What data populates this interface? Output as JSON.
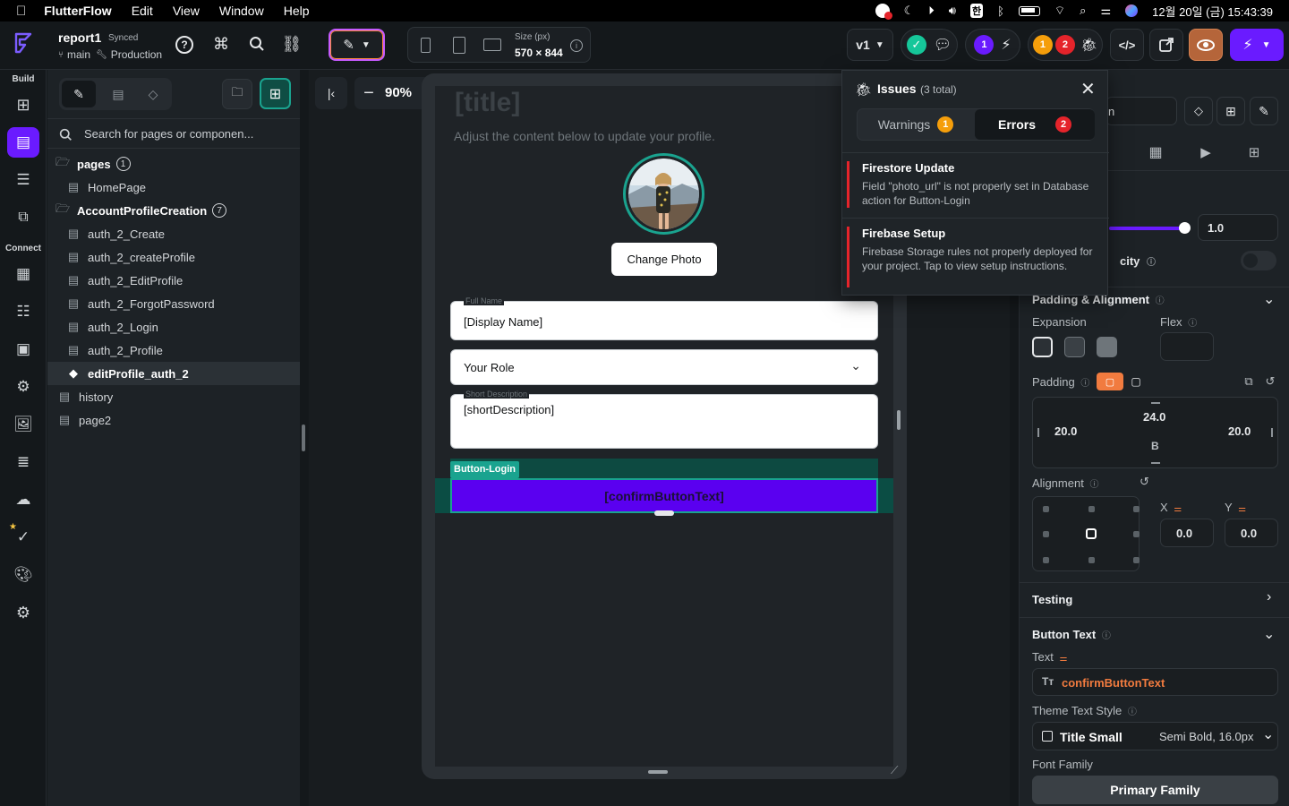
{
  "menubar": {
    "app_name": "FlutterFlow",
    "items": [
      "Edit",
      "View",
      "Window",
      "Help"
    ],
    "datetime": "12월 20일 (금)  15:43:39",
    "ime": "한"
  },
  "project": {
    "name": "report1",
    "sync_status": "Synced",
    "branch": "main",
    "environment": "Production"
  },
  "toolbar": {
    "size_label": "Size (px)",
    "size_value": "570 × 844",
    "version": "v1",
    "badge_purple": "1",
    "badge_orange": "1",
    "badge_red": "2"
  },
  "leftnav": {
    "build_label": "Build",
    "connect_label": "Connect"
  },
  "panel": {
    "search_placeholder": "Search for pages or componen...",
    "tree": [
      {
        "label": "pages",
        "count": "1",
        "type": "folder"
      },
      {
        "label": "HomePage",
        "type": "page"
      },
      {
        "label": "AccountProfileCreation",
        "count": "7",
        "type": "folder"
      },
      {
        "label": "auth_2_Create",
        "type": "page"
      },
      {
        "label": "auth_2_createProfile",
        "type": "page"
      },
      {
        "label": "auth_2_EditProfile",
        "type": "page"
      },
      {
        "label": "auth_2_ForgotPassword",
        "type": "page"
      },
      {
        "label": "auth_2_Login",
        "type": "page"
      },
      {
        "label": "auth_2_Profile",
        "type": "page"
      },
      {
        "label": "editProfile_auth_2",
        "type": "page",
        "selected": true
      },
      {
        "label": "history",
        "type": "page"
      },
      {
        "label": "page2",
        "type": "page"
      }
    ]
  },
  "canvas": {
    "zoom": "90%",
    "screen": {
      "title": "[title]",
      "subtitle": "Adjust the content below to update your profile.",
      "change_photo": "Change Photo",
      "full_name_label": "Full Name",
      "full_name_value": "[Display Name]",
      "role_value": "Your Role",
      "short_desc_label": "Short Description",
      "short_desc_value": "[shortDescription]",
      "widget_tag": "Button-Login",
      "button_text": "[confirmButtonText]"
    }
  },
  "issues": {
    "title": "Issues",
    "total": "(3 total)",
    "tab_warnings": "Warnings",
    "warnings_count": "1",
    "tab_errors": "Errors",
    "errors_count": "2",
    "items": [
      {
        "title": "Firestore Update",
        "body": "Field \"photo_url\" is not properly set in Database action for Button-Login"
      },
      {
        "title": "Firebase Setup",
        "body": "Firebase Storage rules not properly deployed for your project. Tap to view setup instructions."
      }
    ]
  },
  "properties": {
    "search_value": "n",
    "opacity_value": "1.0",
    "opacity_fraction": 1.0,
    "visibility_label_tail": "city",
    "padding_alignment_title": "Padding & Alignment",
    "expansion_label": "Expansion",
    "flex_label": "Flex",
    "padding_label": "Padding",
    "padding_top": "24.0",
    "padding_left": "20.0",
    "padding_right": "20.0",
    "padding_bottom": "B",
    "alignment_label": "Alignment",
    "x_label": "X",
    "y_label": "Y",
    "x_value": "0.0",
    "y_value": "0.0",
    "testing_title": "Testing",
    "button_text_title": "Button Text",
    "text_label": "Text",
    "text_value": "confirmButtonText",
    "theme_style_label": "Theme Text Style",
    "theme_style_name": "Title Small",
    "theme_style_detail": "Semi Bold, 16.0px",
    "font_family_label": "Font Family",
    "font_family_value": "Primary Family"
  },
  "colors": {
    "accent_purple": "#6a1bff",
    "teal": "#1aa38f",
    "error_red": "#e5242b",
    "warning_orange": "#f59e0b",
    "padding_orange": "#f17b3f",
    "text_orange": "#f17b3f"
  }
}
